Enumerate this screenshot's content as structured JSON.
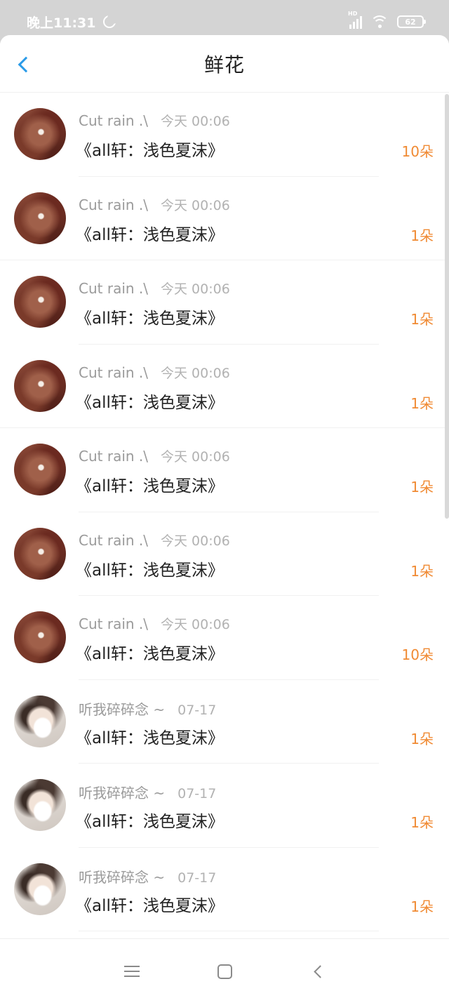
{
  "status_bar": {
    "time": "晚上11:31",
    "signal_label": "HD",
    "battery": "62"
  },
  "header": {
    "title": "鲜花"
  },
  "list": [
    {
      "name": "Cut rain .\\",
      "time": "今天 00:06",
      "title": "《all轩：浅色夏沫》",
      "count": "10朵",
      "avatar": "man-avatar"
    },
    {
      "name": "Cut rain .\\",
      "time": "今天 00:06",
      "title": "《all轩：浅色夏沫》",
      "count": "1朵",
      "avatar": "man-avatar"
    },
    {
      "name": "Cut rain .\\",
      "time": "今天 00:06",
      "title": "《all轩：浅色夏沫》",
      "count": "1朵",
      "avatar": "man-avatar"
    },
    {
      "name": "Cut rain .\\",
      "time": "今天 00:06",
      "title": "《all轩：浅色夏沫》",
      "count": "1朵",
      "avatar": "man-avatar"
    },
    {
      "name": "Cut rain .\\",
      "time": "今天 00:06",
      "title": "《all轩：浅色夏沫》",
      "count": "1朵",
      "avatar": "man-avatar"
    },
    {
      "name": "Cut rain .\\",
      "time": "今天 00:06",
      "title": "《all轩：浅色夏沫》",
      "count": "1朵",
      "avatar": "man-avatar"
    },
    {
      "name": "Cut rain .\\",
      "time": "今天 00:06",
      "title": "《all轩：浅色夏沫》",
      "count": "10朵",
      "avatar": "man-avatar"
    },
    {
      "name": "听我碎碎念 ~",
      "time": "07-17",
      "title": "《all轩：浅色夏沫》",
      "count": "1朵",
      "avatar": "girl-avatar"
    },
    {
      "name": "听我碎碎念 ~",
      "time": "07-17",
      "title": "《all轩：浅色夏沫》",
      "count": "1朵",
      "avatar": "girl-avatar"
    },
    {
      "name": "听我碎碎念 ~",
      "time": "07-17",
      "title": "《all轩：浅色夏沫》",
      "count": "1朵",
      "avatar": "girl-avatar"
    }
  ],
  "colors": {
    "accent": "#2a9be8",
    "count": "#f08a33",
    "status_bar": "#d4d4d4"
  },
  "icons": {
    "back": "chevron-left-icon",
    "moon": "moon-icon",
    "signal": "signal-icon",
    "wifi": "wifi-icon",
    "battery": "battery-icon",
    "menu": "menu-icon",
    "home": "home-icon",
    "nav_back": "nav-back-icon"
  }
}
